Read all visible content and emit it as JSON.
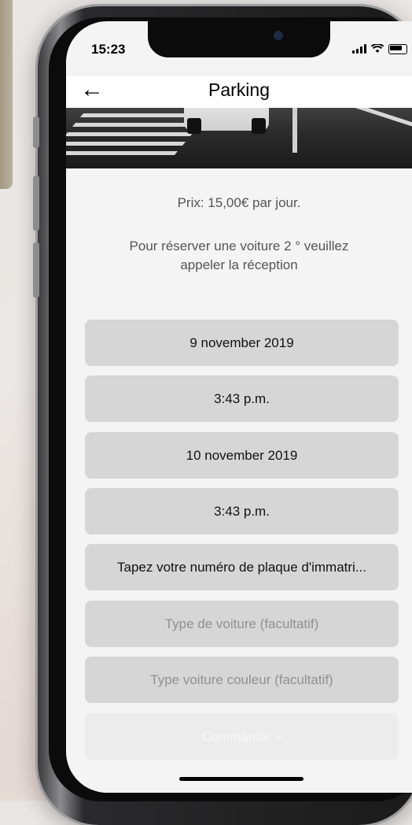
{
  "status_bar": {
    "time": "15:23"
  },
  "navbar": {
    "title": "Parking"
  },
  "content": {
    "price_text": "Prix: 15,00€ par jour.",
    "info_text": "Pour réserver une voiture 2 ° veuillez appeler la réception"
  },
  "form": {
    "start_date": "9 november 2019",
    "start_time": "3:43 p.m.",
    "end_date": "10 november 2019",
    "end_time": "3:43 p.m.",
    "plate_text": "Tapez votre numéro de plaque d'immatri...",
    "car_type_placeholder": "Type de voiture (facultatif)",
    "car_color_placeholder": "Type voiture couleur (facultatif)",
    "submit_label": "Commande »"
  },
  "icons": {
    "back": "arrow-left-icon",
    "signal": "cellular-signal-icon",
    "wifi": "wifi-icon",
    "battery": "battery-icon"
  },
  "colors": {
    "field_bg": "#d6d6d6",
    "screen_bg": "#f4f4f4",
    "disabled_button_bg": "#ececec"
  }
}
